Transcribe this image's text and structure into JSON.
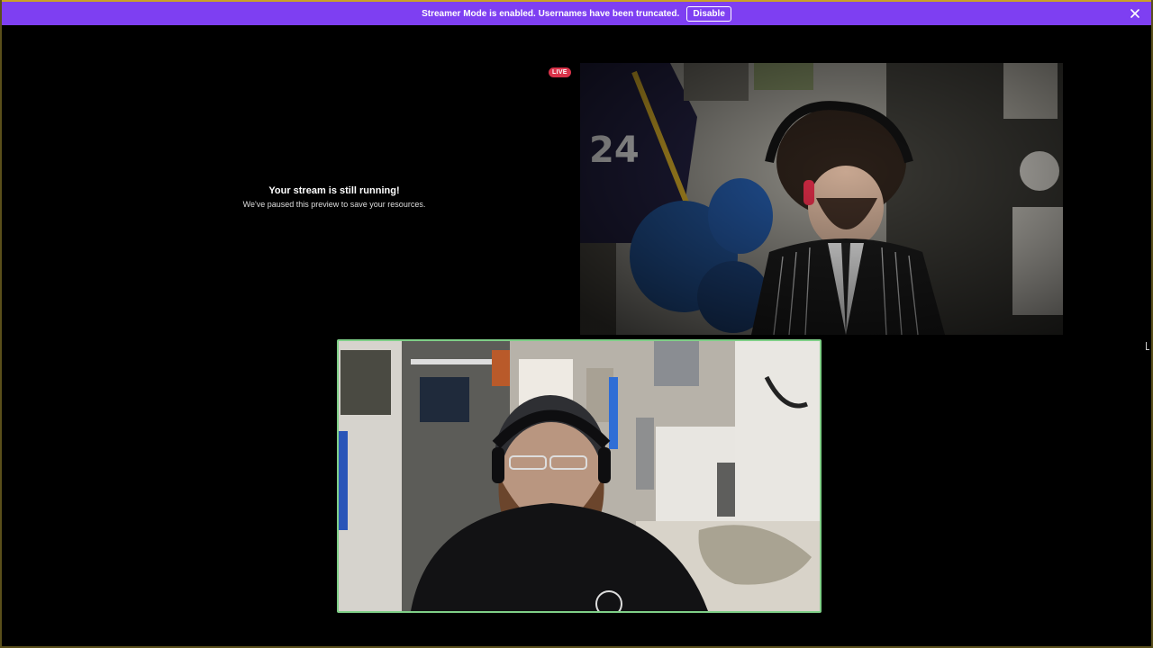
{
  "banner": {
    "message": "Streamer Mode is enabled. Usernames have been truncated.",
    "disable_label": "Disable",
    "close_icon": "close-icon",
    "color": "#7e3ff2"
  },
  "stream_preview": {
    "title": "Your stream is still running!",
    "subtitle": "We've paused this preview to save your resources.",
    "live_label": "LIVE",
    "live_color": "#d9334a"
  },
  "video_tiles": [
    {
      "name": "participant-video-top",
      "active_speaker": false
    },
    {
      "name": "participant-video-bottom",
      "active_speaker": true,
      "speaking_border_color": "#7fcf87"
    }
  ]
}
